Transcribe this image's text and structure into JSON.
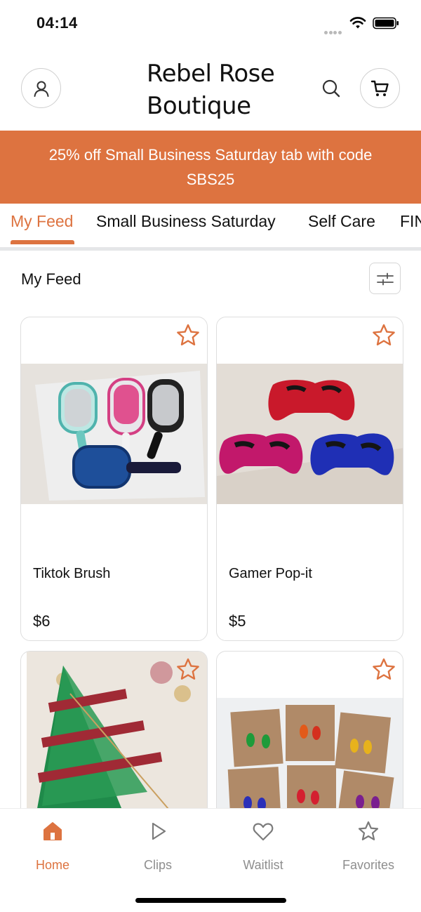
{
  "status_bar": {
    "time": "04:14"
  },
  "header": {
    "title": "Rebel Rose Boutique"
  },
  "promo": {
    "text": "25% off Small Business Saturday tab with code SBS25"
  },
  "tabs": [
    {
      "label": "My Feed",
      "active": true
    },
    {
      "label": "Small Business Saturday",
      "active": false
    },
    {
      "label": "Self Care",
      "active": false
    },
    {
      "label": "FIN",
      "active": false
    }
  ],
  "feed": {
    "title": "My Feed"
  },
  "products": [
    {
      "name": "Tiktok Brush",
      "price": "$6"
    },
    {
      "name": "Gamer Pop-it",
      "price": "$5"
    },
    {
      "name": "",
      "price": ""
    },
    {
      "name": "",
      "price": ""
    }
  ],
  "bottom_nav": [
    {
      "label": "Home",
      "icon": "home-icon",
      "active": true
    },
    {
      "label": "Clips",
      "icon": "play-icon",
      "active": false
    },
    {
      "label": "Waitlist",
      "icon": "heart-icon",
      "active": false
    },
    {
      "label": "Favorites",
      "icon": "star-icon",
      "active": false
    }
  ],
  "colors": {
    "accent": "#dd7340",
    "muted": "#8e8e8e",
    "divider": "#e5e6e8"
  }
}
